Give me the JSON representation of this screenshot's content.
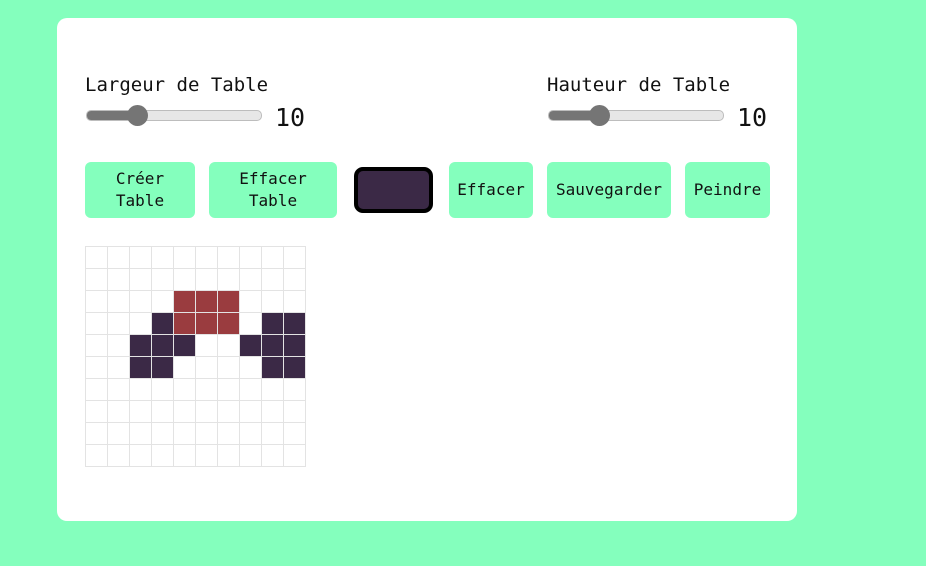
{
  "controls": {
    "width": {
      "label": "Largeur de Table",
      "value": "10",
      "fill_fraction": 0.3
    },
    "height": {
      "label": "Hauteur de Table",
      "value": "10",
      "fill_fraction": 0.3
    }
  },
  "buttons": {
    "create": "Créer Table",
    "clear_table": "Effacer Table",
    "erase": "Effacer",
    "save": "Sauvegarder",
    "paint": "Peindre"
  },
  "colors": {
    "background": "#84ffbd",
    "selected": "#3b2946",
    "red": "#9a3c3f",
    "dark": "#3b2946",
    "empty": "#ffffff"
  },
  "grid": {
    "rows": 10,
    "cols": 10,
    "cells": [
      [
        ".",
        ".",
        ".",
        ".",
        ".",
        ".",
        ".",
        ".",
        ".",
        "."
      ],
      [
        ".",
        ".",
        ".",
        ".",
        ".",
        ".",
        ".",
        ".",
        ".",
        "."
      ],
      [
        ".",
        ".",
        ".",
        ".",
        "R",
        "R",
        "R",
        ".",
        ".",
        "."
      ],
      [
        ".",
        ".",
        ".",
        "D",
        "R",
        "R",
        "R",
        ".",
        "D",
        "D"
      ],
      [
        ".",
        ".",
        "D",
        "D",
        "D",
        ".",
        ".",
        "D",
        "D",
        "D"
      ],
      [
        ".",
        ".",
        "D",
        "D",
        ".",
        ".",
        ".",
        ".",
        "D",
        "D"
      ],
      [
        ".",
        ".",
        ".",
        ".",
        ".",
        ".",
        ".",
        ".",
        ".",
        "."
      ],
      [
        ".",
        ".",
        ".",
        ".",
        ".",
        ".",
        ".",
        ".",
        ".",
        "."
      ],
      [
        ".",
        ".",
        ".",
        ".",
        ".",
        ".",
        ".",
        ".",
        ".",
        "."
      ],
      [
        ".",
        ".",
        ".",
        ".",
        ".",
        ".",
        ".",
        ".",
        ".",
        "."
      ]
    ]
  }
}
